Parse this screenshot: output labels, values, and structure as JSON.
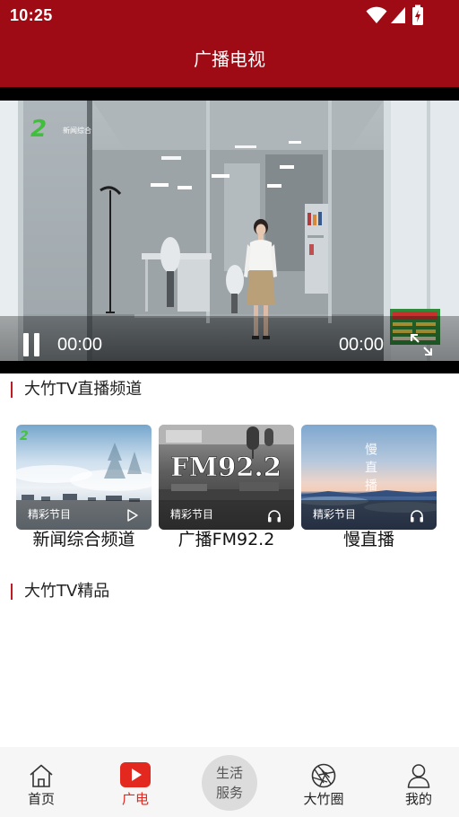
{
  "status_bar": {
    "time": "10:25",
    "icons": [
      "wifi-icon",
      "signal-icon",
      "battery-charging-icon"
    ]
  },
  "header": {
    "title": "广播电视"
  },
  "video_player": {
    "channel_logo": "2",
    "channel_name": "新闻综合",
    "current_time": "00:00",
    "duration": "00:00",
    "play_state_icon": "pause-icon",
    "fullscreen_icon": "fullscreen-icon"
  },
  "live_channels": {
    "title": "大竹TV直播频道",
    "cards": [
      {
        "tag": "精彩节目",
        "action_icon": "play-icon",
        "label": "新闻综合频道",
        "logo": "2"
      },
      {
        "tag": "精彩节目",
        "action_icon": "headphones-icon",
        "label": "广播FM92.2",
        "image_text": "FM92.2"
      },
      {
        "tag": "精彩节目",
        "action_icon": "headphones-icon",
        "label": "慢直播",
        "image_text": "慢直播"
      }
    ]
  },
  "featured": {
    "title": "大竹TV精品"
  },
  "bottom_nav": {
    "items": [
      {
        "label": "首页",
        "icon": "home-icon",
        "active": false
      },
      {
        "label": "广电",
        "icon": "tv-play-icon",
        "active": true
      },
      {
        "label": "生活服务",
        "icon": "",
        "active": false
      },
      {
        "label": "大竹圈",
        "icon": "aperture-icon",
        "active": false
      },
      {
        "label": "我的",
        "icon": "user-icon",
        "active": false
      }
    ]
  },
  "colors": {
    "brand": "#9e0b14",
    "nav_active": "#e2281f",
    "section_marker": "#c01a22",
    "nav_background": "#f6f6f6"
  }
}
